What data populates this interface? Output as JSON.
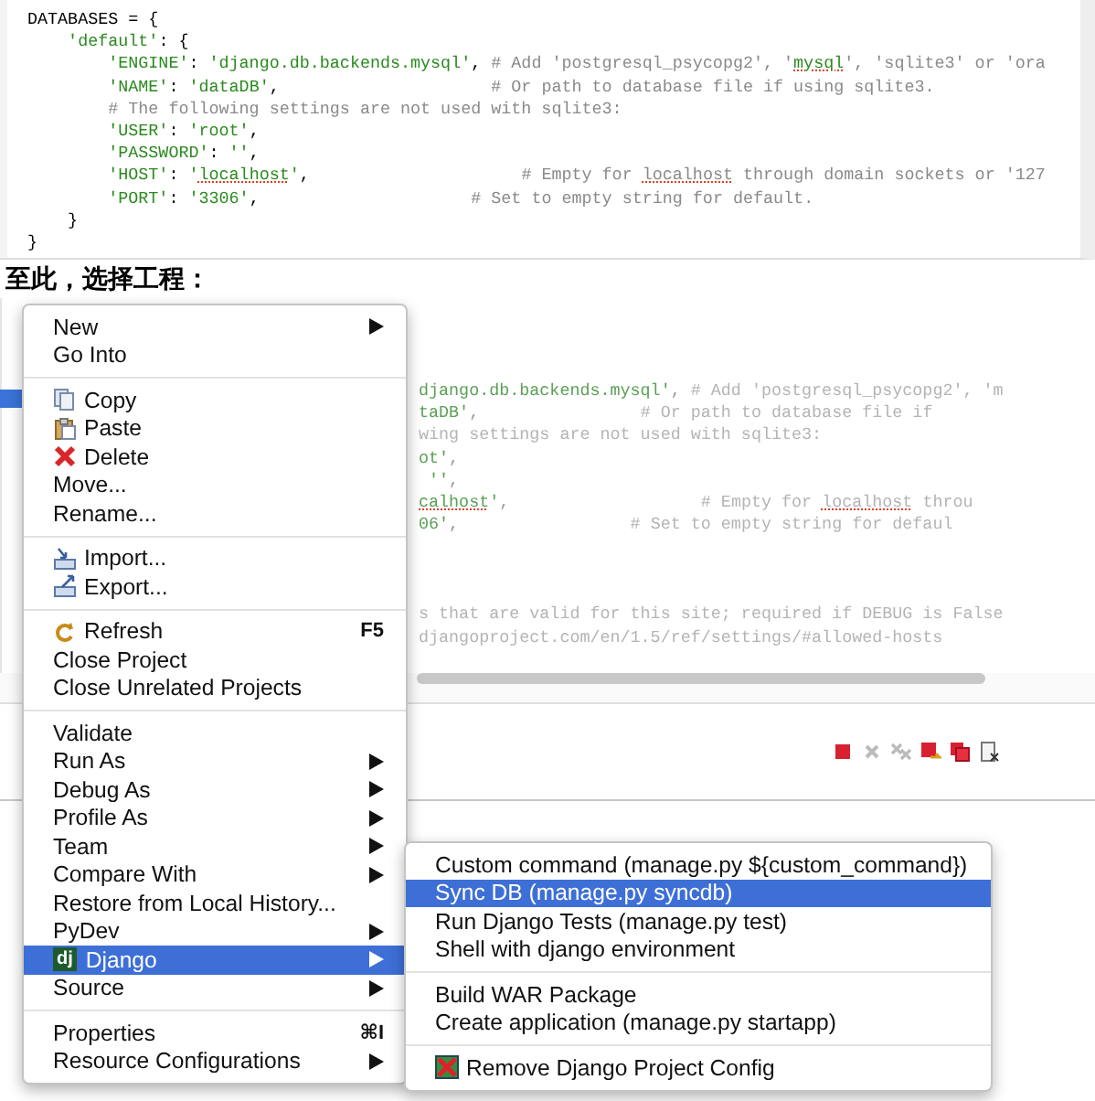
{
  "code_block": {
    "lines": [
      [
        {
          "kind": "code",
          "text": "DATABASES = {"
        }
      ],
      [
        {
          "kind": "string",
          "text": "    'default'"
        },
        {
          "kind": "code",
          "text": ": {"
        }
      ],
      [
        {
          "kind": "string",
          "text": "        'ENGINE'"
        },
        {
          "kind": "code",
          "text": ": "
        },
        {
          "kind": "string",
          "text": "'django.db.backends.mysql'"
        },
        {
          "kind": "code",
          "text": ", "
        },
        {
          "kind": "comment",
          "text": "# Add 'postgresql_psycopg2', '"
        },
        {
          "kind": "flagged",
          "text": "mysql"
        },
        {
          "kind": "comment",
          "text": "', 'sqlite3' or 'ora"
        }
      ],
      [
        {
          "kind": "string",
          "text": "        'NAME'"
        },
        {
          "kind": "code",
          "text": ": "
        },
        {
          "kind": "string",
          "text": "'dataDB'"
        },
        {
          "kind": "code",
          "text": ",                     "
        },
        {
          "kind": "comment",
          "text": "# Or path to database file if using sqlite3."
        }
      ],
      [
        {
          "kind": "comment",
          "text": "        # The following settings are not used with sqlite3:"
        }
      ],
      [
        {
          "kind": "string",
          "text": "        'USER'"
        },
        {
          "kind": "code",
          "text": ": "
        },
        {
          "kind": "string",
          "text": "'root'"
        },
        {
          "kind": "code",
          "text": ","
        }
      ],
      [
        {
          "kind": "string",
          "text": "        'PASSWORD'"
        },
        {
          "kind": "code",
          "text": ": "
        },
        {
          "kind": "string",
          "text": "''"
        },
        {
          "kind": "code",
          "text": ","
        }
      ],
      [
        {
          "kind": "string",
          "text": "        'HOST'"
        },
        {
          "kind": "code",
          "text": ": "
        },
        {
          "kind": "string",
          "text": "'"
        },
        {
          "kind": "flagged",
          "text": "localhost"
        },
        {
          "kind": "string",
          "text": "'"
        },
        {
          "kind": "code",
          "text": ",                     "
        },
        {
          "kind": "comment",
          "text": "# Empty for "
        },
        {
          "kind": "flagged_comment",
          "text": "localhost"
        },
        {
          "kind": "comment",
          "text": " through domain sockets or '127"
        }
      ],
      [
        {
          "kind": "string",
          "text": "        'PORT'"
        },
        {
          "kind": "code",
          "text": ": "
        },
        {
          "kind": "string",
          "text": "'3306'"
        },
        {
          "kind": "code",
          "text": ",                     "
        },
        {
          "kind": "comment",
          "text": "# Set to empty string for default."
        }
      ],
      [
        {
          "kind": "code",
          "text": "    }"
        }
      ],
      [
        {
          "kind": "code",
          "text": "}"
        }
      ]
    ]
  },
  "heading": "至此，选择工程：",
  "background_editor": {
    "blocks": [
      [
        [
          {
            "kind": "string",
            "text": "django.db.backends.mysql'"
          },
          {
            "kind": "code",
            "text": ", "
          },
          {
            "kind": "comment",
            "text": "# Add 'postgresql_psycopg2', 'm"
          }
        ],
        [
          {
            "kind": "string",
            "text": "taDB'"
          },
          {
            "kind": "code",
            "text": ",                "
          },
          {
            "kind": "comment",
            "text": "# Or path to database file if"
          }
        ],
        [
          {
            "kind": "comment",
            "text": "wing settings are not used with sqlite3:"
          }
        ],
        [
          {
            "kind": "string",
            "text": "ot'"
          },
          {
            "kind": "code",
            "text": ","
          }
        ],
        [
          {
            "kind": "string",
            "text": " ''"
          },
          {
            "kind": "code",
            "text": ","
          }
        ],
        [
          {
            "kind": "flagged",
            "text": "calhost"
          },
          {
            "kind": "string",
            "text": "'"
          },
          {
            "kind": "code",
            "text": ",                   "
          },
          {
            "kind": "comment",
            "text": "# Empty for "
          },
          {
            "kind": "flagged_comment",
            "text": "localhost"
          },
          {
            "kind": "comment",
            "text": " throu"
          }
        ],
        [
          {
            "kind": "string",
            "text": "06'"
          },
          {
            "kind": "code",
            "text": ",                 "
          },
          {
            "kind": "comment",
            "text": "# Set to empty string for defaul"
          }
        ]
      ],
      [
        [
          {
            "kind": "comment",
            "text": "s that are valid for this site; required if DEBUG is False"
          }
        ],
        [
          {
            "kind": "comment",
            "text": "djangoproject.com/en/1.5/ref/settings/#allowed-hosts"
          }
        ]
      ]
    ]
  },
  "context_menu": {
    "items": [
      {
        "kind": "item",
        "label": "New",
        "submenu": true,
        "selected": false
      },
      {
        "kind": "item",
        "label": "Go Into",
        "submenu": false,
        "selected": false
      },
      {
        "kind": "separator"
      },
      {
        "kind": "item",
        "label": "Copy",
        "submenu": false,
        "selected": false
      },
      {
        "kind": "item",
        "label": "Paste",
        "submenu": false,
        "selected": false
      },
      {
        "kind": "item",
        "label": "Delete",
        "submenu": false,
        "selected": false
      },
      {
        "kind": "item",
        "label": "Move...",
        "submenu": false,
        "selected": false
      },
      {
        "kind": "item",
        "label": "Rename...",
        "submenu": false,
        "selected": false
      },
      {
        "kind": "separator"
      },
      {
        "kind": "item",
        "label": "Import...",
        "submenu": false,
        "selected": false
      },
      {
        "kind": "item",
        "label": "Export...",
        "submenu": false,
        "selected": false
      },
      {
        "kind": "separator"
      },
      {
        "kind": "item",
        "label": "Refresh",
        "shortcut": "F5",
        "submenu": false,
        "selected": false
      },
      {
        "kind": "item",
        "label": "Close Project",
        "submenu": false,
        "selected": false
      },
      {
        "kind": "item",
        "label": "Close Unrelated Projects",
        "submenu": false,
        "selected": false
      },
      {
        "kind": "separator"
      },
      {
        "kind": "item",
        "label": "Validate",
        "submenu": false,
        "selected": false
      },
      {
        "kind": "item",
        "label": "Run As",
        "submenu": true,
        "selected": false
      },
      {
        "kind": "item",
        "label": "Debug As",
        "submenu": true,
        "selected": false
      },
      {
        "kind": "item",
        "label": "Profile As",
        "submenu": true,
        "selected": false
      },
      {
        "kind": "item",
        "label": "Team",
        "submenu": true,
        "selected": false
      },
      {
        "kind": "item",
        "label": "Compare With",
        "submenu": true,
        "selected": false
      },
      {
        "kind": "item",
        "label": "Restore from Local History...",
        "submenu": false,
        "selected": false
      },
      {
        "kind": "item",
        "label": "PyDev",
        "submenu": true,
        "selected": false
      },
      {
        "kind": "item",
        "label": "Django",
        "badge": "dj",
        "submenu": true,
        "selected": true
      },
      {
        "kind": "item",
        "label": "Source",
        "submenu": true,
        "selected": false
      },
      {
        "kind": "separator"
      },
      {
        "kind": "item",
        "label": "Properties",
        "shortcut": "⌘I",
        "submenu": false,
        "selected": false
      },
      {
        "kind": "item",
        "label": "Resource Configurations",
        "submenu": true,
        "selected": false
      }
    ]
  },
  "django_submenu": {
    "items": [
      {
        "kind": "item",
        "label": "Custom command (manage.py ${custom_command})",
        "selected": false
      },
      {
        "kind": "item",
        "label": "Sync DB (manage.py syncdb)",
        "selected": true
      },
      {
        "kind": "item",
        "label": "Run Django Tests (manage.py test)",
        "selected": false
      },
      {
        "kind": "item",
        "label": "Shell with django environment",
        "selected": false
      },
      {
        "kind": "separator"
      },
      {
        "kind": "item",
        "label": "Build WAR Package",
        "selected": false
      },
      {
        "kind": "item",
        "label": "Create application (manage.py startapp)",
        "selected": false
      },
      {
        "kind": "separator"
      },
      {
        "kind": "item",
        "label": "Remove Django Project Config",
        "selected": false
      }
    ]
  }
}
